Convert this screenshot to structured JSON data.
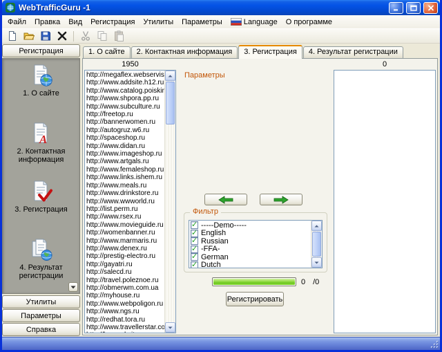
{
  "colors": {
    "titlebar_blue": "#0453E6",
    "active_tab_accent": "#E68A00",
    "section_label_orange": "#C25608",
    "progress_fill_green": "#7ECB2B",
    "checkmark_green": "#21A121",
    "arrow_green": "#2DA32D"
  },
  "window": {
    "title": "WebTrafficGuru -1"
  },
  "menu": {
    "items": [
      "Файл",
      "Правка",
      "Вид",
      "Регистрация",
      "Утилиты",
      "Параметры",
      "Language",
      "О программе"
    ]
  },
  "toolbar": {
    "icons": [
      "new-document-icon",
      "open-folder-icon",
      "save-icon",
      "delete-icon",
      "cut-icon",
      "copy-icon",
      "paste-icon"
    ]
  },
  "sidebar": {
    "header": "Регистрация",
    "items": [
      {
        "label": "1. О сайте",
        "icon": "document-globe-icon"
      },
      {
        "label": "2. Контактная информация",
        "icon": "document-contact-icon"
      },
      {
        "label": "3. Регистрация",
        "icon": "document-check-icon"
      },
      {
        "label": "4. Результат регистрации",
        "icon": "document-result-icon"
      }
    ],
    "footer_buttons": [
      "Утилиты",
      "Параметры",
      "Справка"
    ]
  },
  "tabs": {
    "active_index": 2,
    "items": [
      "1. О сайте",
      "2. Контактная информация",
      "3. Регистрация",
      "4. Результат регистрации"
    ]
  },
  "main": {
    "url_count": "1950",
    "result_count": "0",
    "params_label": "Параметры",
    "urls": [
      "http://megaflex.webservis.ru",
      "http://www.addsite.h12.ru",
      "http://www.catalog.poiskinfo",
      "http://www.shpora.pp.ru",
      "http://www.subculture.ru",
      "http://freetop.ru",
      "http://bannerwomen.ru",
      "http://autogruz.w6.ru",
      "http://spaceshop.ru",
      "http://www.didan.ru",
      "http://www.imageshop.ru",
      "http://www.artgals.ru",
      "http://www.femaleshop.ru",
      "http://www.links.ishem.ru",
      "http://www.meals.ru",
      "http://www.drinkstore.ru",
      "http://www.wwworld.ru",
      "http://list.perm.ru",
      "http://www.rsex.ru",
      "http://www.movieguide.ru",
      "http://womenbanner.ru",
      "http://www.marmaris.ru",
      "http://www.denex.ru",
      "http://prestig-electro.ru",
      "http://gayatri.ru",
      "http://salecd.ru",
      "http://travel.poleznoe.ru",
      "http://obmerwm.com.ua",
      "http://myhouse.ru",
      "http://www.webpoligon.ru",
      "http://www.ngs.ru",
      "http://redhat.tora.ru",
      "http://www.travellerstar.com",
      "http://bryanskcity.ru"
    ],
    "filter": {
      "title": "Фильтр",
      "options": [
        {
          "label": "-----Demo-----",
          "checked": true
        },
        {
          "label": "English",
          "checked": true
        },
        {
          "label": "Russian",
          "checked": true
        },
        {
          "label": "-FFA-",
          "checked": true
        },
        {
          "label": "German",
          "checked": true
        },
        {
          "label": "Dutch",
          "checked": true
        }
      ]
    },
    "progress": {
      "current": "0",
      "total": "/0"
    },
    "register_button": "Регистрировать"
  }
}
